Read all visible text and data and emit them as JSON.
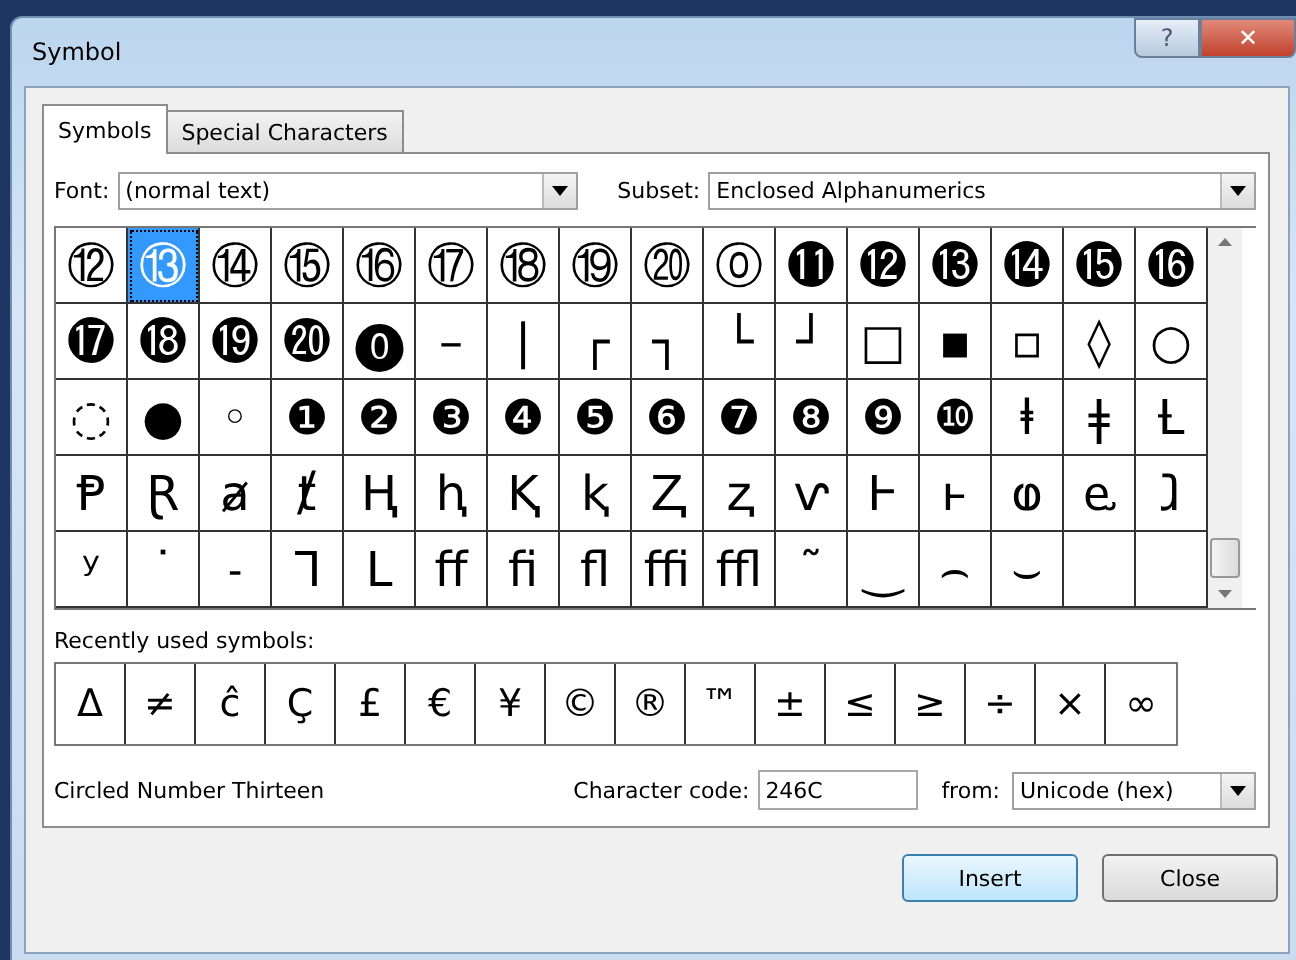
{
  "window": {
    "title": "Symbol",
    "help_button": "?",
    "close_button": "✕"
  },
  "tabs": [
    {
      "label": "Symbols",
      "selected": true
    },
    {
      "label": "Special Characters",
      "selected": false
    }
  ],
  "font": {
    "label": "Font:",
    "value": "(normal text)"
  },
  "subset": {
    "label": "Subset:",
    "value": "Enclosed Alphanumerics"
  },
  "grid": {
    "rows": [
      {
        "symbols": [
          {
            "char": "⑫",
            "selected": false
          },
          {
            "char": "⑬",
            "selected": true
          },
          {
            "char": "⑭",
            "selected": false
          },
          {
            "char": "⑮",
            "selected": false
          },
          {
            "char": "⑯",
            "selected": false
          },
          {
            "char": "⑰",
            "selected": false
          },
          {
            "char": "⑱",
            "selected": false
          },
          {
            "char": "⑲",
            "selected": false
          },
          {
            "char": "⑳",
            "selected": false
          },
          {
            "char": "⓪",
            "selected": false
          },
          {
            "char": "⓫",
            "selected": false
          },
          {
            "char": "⓬",
            "selected": false
          },
          {
            "char": "⓭",
            "selected": false
          },
          {
            "char": "⓮",
            "selected": false
          },
          {
            "char": "⓯",
            "selected": false
          },
          {
            "char": "⓰",
            "selected": false
          }
        ]
      },
      {
        "symbols": [
          {
            "char": "⓱",
            "selected": false
          },
          {
            "char": "⓲",
            "selected": false
          },
          {
            "char": "⓳",
            "selected": false
          },
          {
            "char": "⓴",
            "selected": false
          },
          {
            "char": "⓿",
            "selected": false
          },
          {
            "char": "–",
            "selected": false
          },
          {
            "char": "|",
            "selected": false
          },
          {
            "char": "┌",
            "selected": false
          },
          {
            "char": "┐",
            "selected": false
          },
          {
            "char": "└",
            "selected": false
          },
          {
            "char": "┘",
            "selected": false
          },
          {
            "char": "□",
            "selected": false
          },
          {
            "char": "▪",
            "selected": false
          },
          {
            "char": "▫",
            "selected": false
          },
          {
            "char": "◊",
            "selected": false
          },
          {
            "char": "○",
            "selected": false
          }
        ]
      },
      {
        "symbols": [
          {
            "char": "◌",
            "selected": false
          },
          {
            "char": "●",
            "selected": false
          },
          {
            "char": "◦",
            "selected": false
          },
          {
            "char": "❶",
            "selected": false
          },
          {
            "char": "❷",
            "selected": false
          },
          {
            "char": "❸",
            "selected": false
          },
          {
            "char": "❹",
            "selected": false
          },
          {
            "char": "❺",
            "selected": false
          },
          {
            "char": "❻",
            "selected": false
          },
          {
            "char": "❼",
            "selected": false
          },
          {
            "char": "❽",
            "selected": false
          },
          {
            "char": "❾",
            "selected": false
          },
          {
            "char": "❿",
            "selected": false
          },
          {
            "char": "ⱡ",
            "selected": false
          },
          {
            "char": "ǂ",
            "selected": false
          },
          {
            "char": "Ƚ",
            "selected": false
          }
        ]
      },
      {
        "symbols": [
          {
            "char": "Ᵽ",
            "selected": false
          },
          {
            "char": "Ɽ",
            "selected": false
          },
          {
            "char": "ⱥ",
            "selected": false
          },
          {
            "char": "ⱦ",
            "selected": false
          },
          {
            "char": "Ⱨ",
            "selected": false
          },
          {
            "char": "ⱨ",
            "selected": false
          },
          {
            "char": "Ⱪ",
            "selected": false
          },
          {
            "char": "ⱪ",
            "selected": false
          },
          {
            "char": "Ⱬ",
            "selected": false
          },
          {
            "char": "ⱬ",
            "selected": false
          },
          {
            "char": "ⱱ",
            "selected": false
          },
          {
            "char": "Ⱶ",
            "selected": false
          },
          {
            "char": "ⱶ",
            "selected": false
          },
          {
            "char": "ⱷ",
            "selected": false
          },
          {
            "char": "ⱸ",
            "selected": false
          },
          {
            "char": "ⱹ",
            "selected": false
          }
        ]
      },
      {
        "symbols": [
          {
            "char": "ʸ",
            "selected": false
          },
          {
            "char": "˙",
            "selected": false
          },
          {
            "char": "˗",
            "selected": false
          },
          {
            "char": "ᒣ",
            "selected": false
          },
          {
            "char": "ᒪ",
            "selected": false
          },
          {
            "char": "ﬀ",
            "selected": false
          },
          {
            "char": "ﬁ",
            "selected": false
          },
          {
            "char": "ﬂ",
            "selected": false
          },
          {
            "char": "ﬃ",
            "selected": false
          },
          {
            "char": "ﬄ",
            "selected": false
          },
          {
            "char": "˜",
            "selected": false
          },
          {
            "char": "‿",
            "selected": false
          },
          {
            "char": "⌢",
            "selected": false
          },
          {
            "char": "⌣",
            "selected": false
          }
        ]
      }
    ]
  },
  "recent": {
    "label": "Recently used symbols:",
    "symbols": [
      "Δ",
      "≠",
      "ĉ",
      "Ç",
      "£",
      "€",
      "¥",
      "©",
      "®",
      "™",
      "±",
      "≤",
      "≥",
      "÷",
      "×",
      "∞"
    ]
  },
  "description": "Circled Number Thirteen",
  "character_code": {
    "label": "Character code:",
    "value": "246C"
  },
  "from": {
    "label": "from:",
    "value": "Unicode (hex)"
  },
  "buttons": [
    {
      "label": "Insert",
      "default": true
    },
    {
      "label": "Close",
      "default": false
    }
  ]
}
